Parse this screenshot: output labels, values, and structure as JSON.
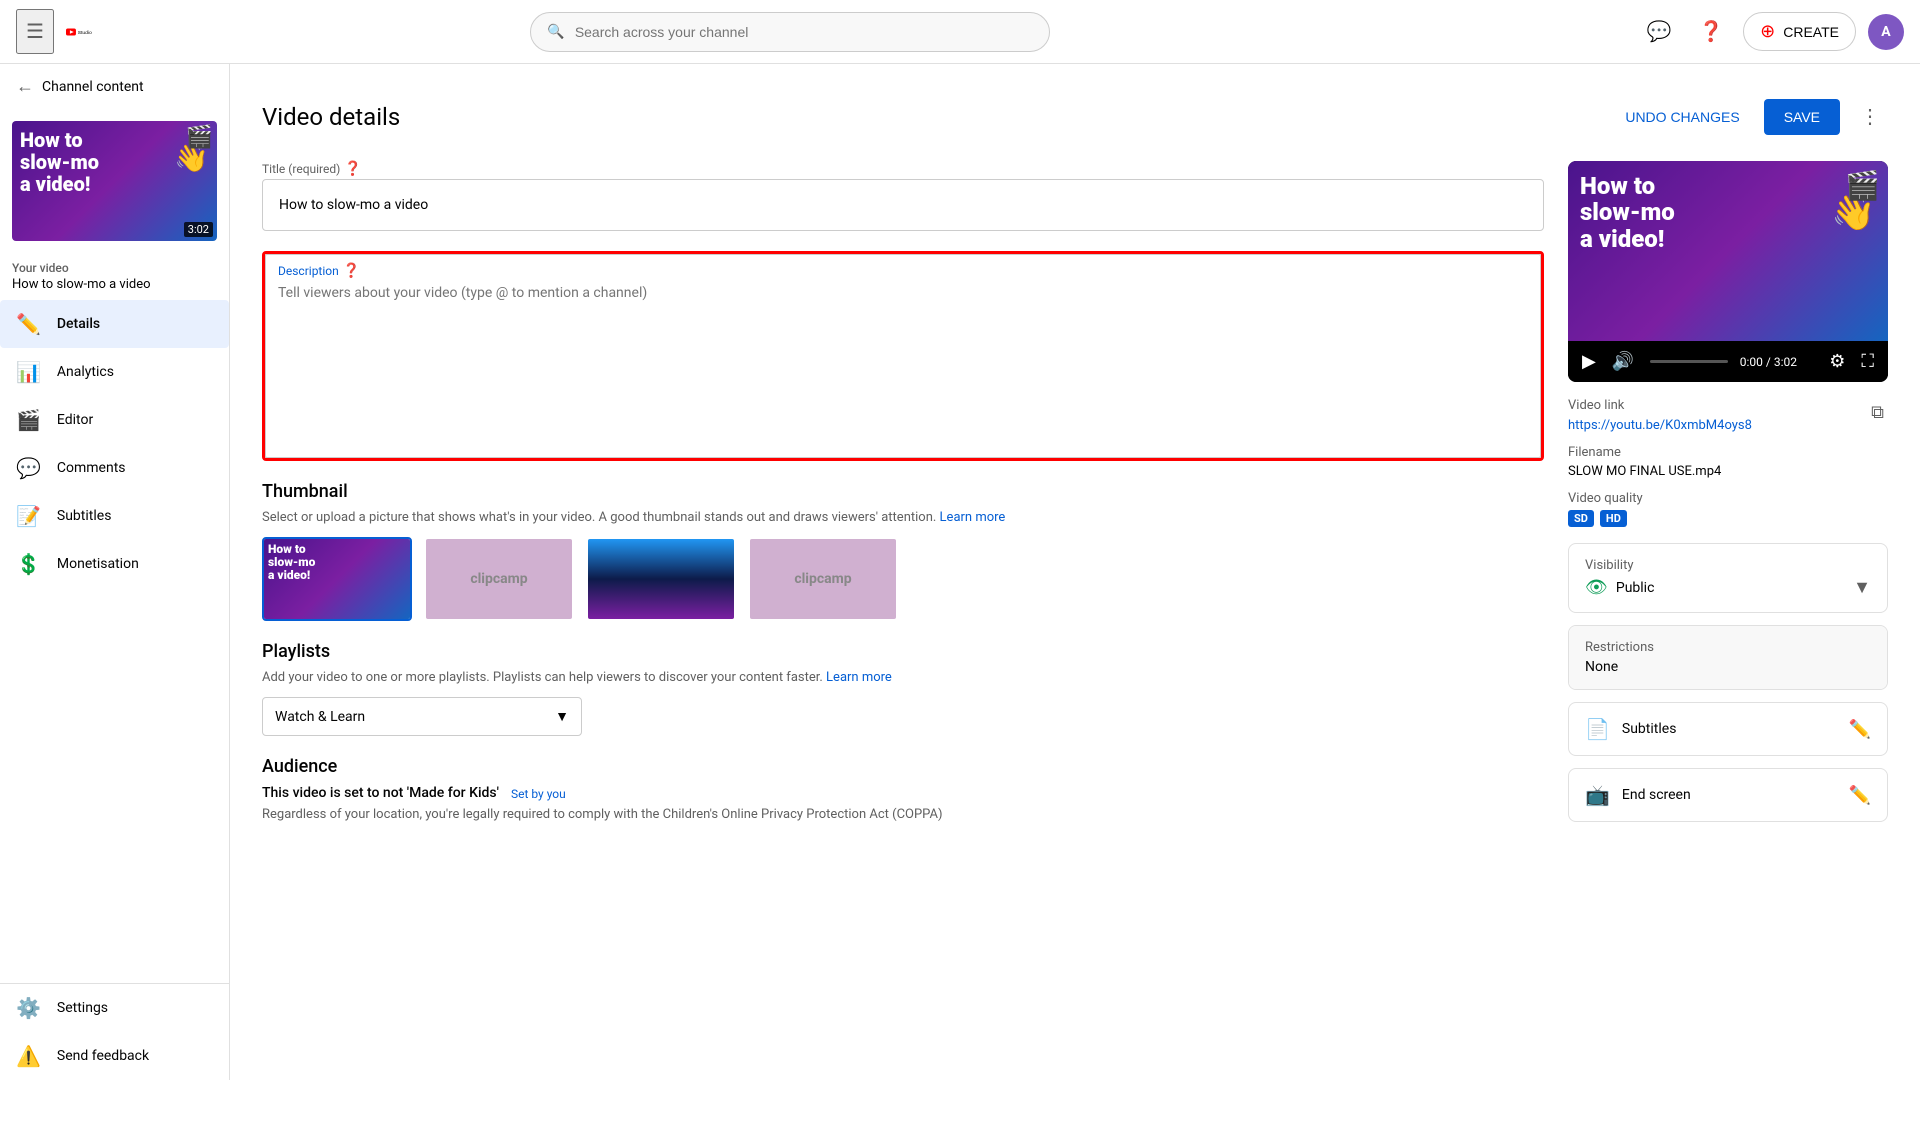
{
  "topnav": {
    "search_placeholder": "Search across your channel",
    "create_label": "CREATE",
    "avatar_initials": "A"
  },
  "sidebar": {
    "video_title": "Your video",
    "video_name": "How to slow-mo a video",
    "thumb_duration": "3:02",
    "nav_items": [
      {
        "id": "details",
        "label": "Details",
        "icon": "✏️",
        "active": true
      },
      {
        "id": "analytics",
        "label": "Analytics",
        "icon": "📊",
        "active": false
      },
      {
        "id": "editor",
        "label": "Editor",
        "icon": "🎬",
        "active": false
      },
      {
        "id": "comments",
        "label": "Comments",
        "icon": "💬",
        "active": false
      },
      {
        "id": "subtitles",
        "label": "Subtitles",
        "icon": "📝",
        "active": false
      },
      {
        "id": "monetisation",
        "label": "Monetisation",
        "icon": "💲",
        "active": false
      }
    ],
    "settings_label": "Settings",
    "feedback_label": "Send feedback",
    "channel_content": "Channel content"
  },
  "page": {
    "title": "Video details",
    "undo_label": "UNDO CHANGES",
    "save_label": "SAVE"
  },
  "form": {
    "title_label": "Title (required)",
    "title_value": "How to slow-mo a video",
    "description_label": "Description",
    "description_placeholder": "Tell viewers about your video (type @ to mention a channel)",
    "thumbnail_title": "Thumbnail",
    "thumbnail_desc": "Select or upload a picture that shows what's in your video. A good thumbnail stands out and draws viewers' attention.",
    "thumbnail_learn_more": "Learn more",
    "playlists_title": "Playlists",
    "playlists_desc": "Add your video to one or more playlists. Playlists can help viewers to discover your content faster.",
    "playlists_learn_more": "Learn more",
    "playlist_selected": "Watch & Learn",
    "audience_title": "Audience",
    "audience_label": "This video is set to not 'Made for Kids'",
    "audience_set_by": "Set by you",
    "audience_desc": "Regardless of your location, you're legally required to comply with the Children's Online Privacy Protection Act (COPPA)"
  },
  "right_panel": {
    "video_link_label": "Video link",
    "video_link": "https://youtu.be/K0xmbM4oys8",
    "filename_label": "Filename",
    "filename": "SLOW MO FINAL USE.mp4",
    "quality_label": "Video quality",
    "badges": [
      "SD",
      "HD"
    ],
    "time_current": "0:00",
    "time_total": "3:02",
    "visibility_label": "Visibility",
    "visibility_value": "Public",
    "restrictions_label": "Restrictions",
    "restrictions_value": "None",
    "subtitles_label": "Subtitles",
    "end_screen_label": "End screen"
  }
}
